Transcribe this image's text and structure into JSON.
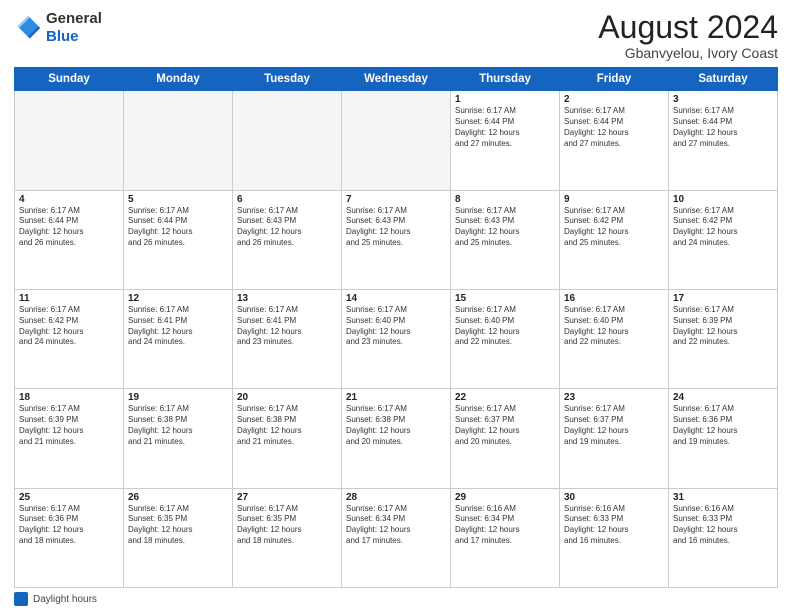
{
  "header": {
    "logo_line1": "General",
    "logo_line2": "Blue",
    "month_year": "August 2024",
    "location": "Gbanvyelou, Ivory Coast"
  },
  "weekdays": [
    "Sunday",
    "Monday",
    "Tuesday",
    "Wednesday",
    "Thursday",
    "Friday",
    "Saturday"
  ],
  "weeks": [
    [
      {
        "day": "",
        "info": ""
      },
      {
        "day": "",
        "info": ""
      },
      {
        "day": "",
        "info": ""
      },
      {
        "day": "",
        "info": ""
      },
      {
        "day": "1",
        "info": "Sunrise: 6:17 AM\nSunset: 6:44 PM\nDaylight: 12 hours\nand 27 minutes."
      },
      {
        "day": "2",
        "info": "Sunrise: 6:17 AM\nSunset: 6:44 PM\nDaylight: 12 hours\nand 27 minutes."
      },
      {
        "day": "3",
        "info": "Sunrise: 6:17 AM\nSunset: 6:44 PM\nDaylight: 12 hours\nand 27 minutes."
      }
    ],
    [
      {
        "day": "4",
        "info": "Sunrise: 6:17 AM\nSunset: 6:44 PM\nDaylight: 12 hours\nand 26 minutes."
      },
      {
        "day": "5",
        "info": "Sunrise: 6:17 AM\nSunset: 6:44 PM\nDaylight: 12 hours\nand 26 minutes."
      },
      {
        "day": "6",
        "info": "Sunrise: 6:17 AM\nSunset: 6:43 PM\nDaylight: 12 hours\nand 26 minutes."
      },
      {
        "day": "7",
        "info": "Sunrise: 6:17 AM\nSunset: 6:43 PM\nDaylight: 12 hours\nand 25 minutes."
      },
      {
        "day": "8",
        "info": "Sunrise: 6:17 AM\nSunset: 6:43 PM\nDaylight: 12 hours\nand 25 minutes."
      },
      {
        "day": "9",
        "info": "Sunrise: 6:17 AM\nSunset: 6:42 PM\nDaylight: 12 hours\nand 25 minutes."
      },
      {
        "day": "10",
        "info": "Sunrise: 6:17 AM\nSunset: 6:42 PM\nDaylight: 12 hours\nand 24 minutes."
      }
    ],
    [
      {
        "day": "11",
        "info": "Sunrise: 6:17 AM\nSunset: 6:42 PM\nDaylight: 12 hours\nand 24 minutes."
      },
      {
        "day": "12",
        "info": "Sunrise: 6:17 AM\nSunset: 6:41 PM\nDaylight: 12 hours\nand 24 minutes."
      },
      {
        "day": "13",
        "info": "Sunrise: 6:17 AM\nSunset: 6:41 PM\nDaylight: 12 hours\nand 23 minutes."
      },
      {
        "day": "14",
        "info": "Sunrise: 6:17 AM\nSunset: 6:40 PM\nDaylight: 12 hours\nand 23 minutes."
      },
      {
        "day": "15",
        "info": "Sunrise: 6:17 AM\nSunset: 6:40 PM\nDaylight: 12 hours\nand 22 minutes."
      },
      {
        "day": "16",
        "info": "Sunrise: 6:17 AM\nSunset: 6:40 PM\nDaylight: 12 hours\nand 22 minutes."
      },
      {
        "day": "17",
        "info": "Sunrise: 6:17 AM\nSunset: 6:39 PM\nDaylight: 12 hours\nand 22 minutes."
      }
    ],
    [
      {
        "day": "18",
        "info": "Sunrise: 6:17 AM\nSunset: 6:39 PM\nDaylight: 12 hours\nand 21 minutes."
      },
      {
        "day": "19",
        "info": "Sunrise: 6:17 AM\nSunset: 6:38 PM\nDaylight: 12 hours\nand 21 minutes."
      },
      {
        "day": "20",
        "info": "Sunrise: 6:17 AM\nSunset: 6:38 PM\nDaylight: 12 hours\nand 21 minutes."
      },
      {
        "day": "21",
        "info": "Sunrise: 6:17 AM\nSunset: 6:38 PM\nDaylight: 12 hours\nand 20 minutes."
      },
      {
        "day": "22",
        "info": "Sunrise: 6:17 AM\nSunset: 6:37 PM\nDaylight: 12 hours\nand 20 minutes."
      },
      {
        "day": "23",
        "info": "Sunrise: 6:17 AM\nSunset: 6:37 PM\nDaylight: 12 hours\nand 19 minutes."
      },
      {
        "day": "24",
        "info": "Sunrise: 6:17 AM\nSunset: 6:36 PM\nDaylight: 12 hours\nand 19 minutes."
      }
    ],
    [
      {
        "day": "25",
        "info": "Sunrise: 6:17 AM\nSunset: 6:36 PM\nDaylight: 12 hours\nand 18 minutes."
      },
      {
        "day": "26",
        "info": "Sunrise: 6:17 AM\nSunset: 6:35 PM\nDaylight: 12 hours\nand 18 minutes."
      },
      {
        "day": "27",
        "info": "Sunrise: 6:17 AM\nSunset: 6:35 PM\nDaylight: 12 hours\nand 18 minutes."
      },
      {
        "day": "28",
        "info": "Sunrise: 6:17 AM\nSunset: 6:34 PM\nDaylight: 12 hours\nand 17 minutes."
      },
      {
        "day": "29",
        "info": "Sunrise: 6:16 AM\nSunset: 6:34 PM\nDaylight: 12 hours\nand 17 minutes."
      },
      {
        "day": "30",
        "info": "Sunrise: 6:16 AM\nSunset: 6:33 PM\nDaylight: 12 hours\nand 16 minutes."
      },
      {
        "day": "31",
        "info": "Sunrise: 6:16 AM\nSunset: 6:33 PM\nDaylight: 12 hours\nand 16 minutes."
      }
    ]
  ],
  "footer": {
    "daylight_label": "Daylight hours"
  }
}
